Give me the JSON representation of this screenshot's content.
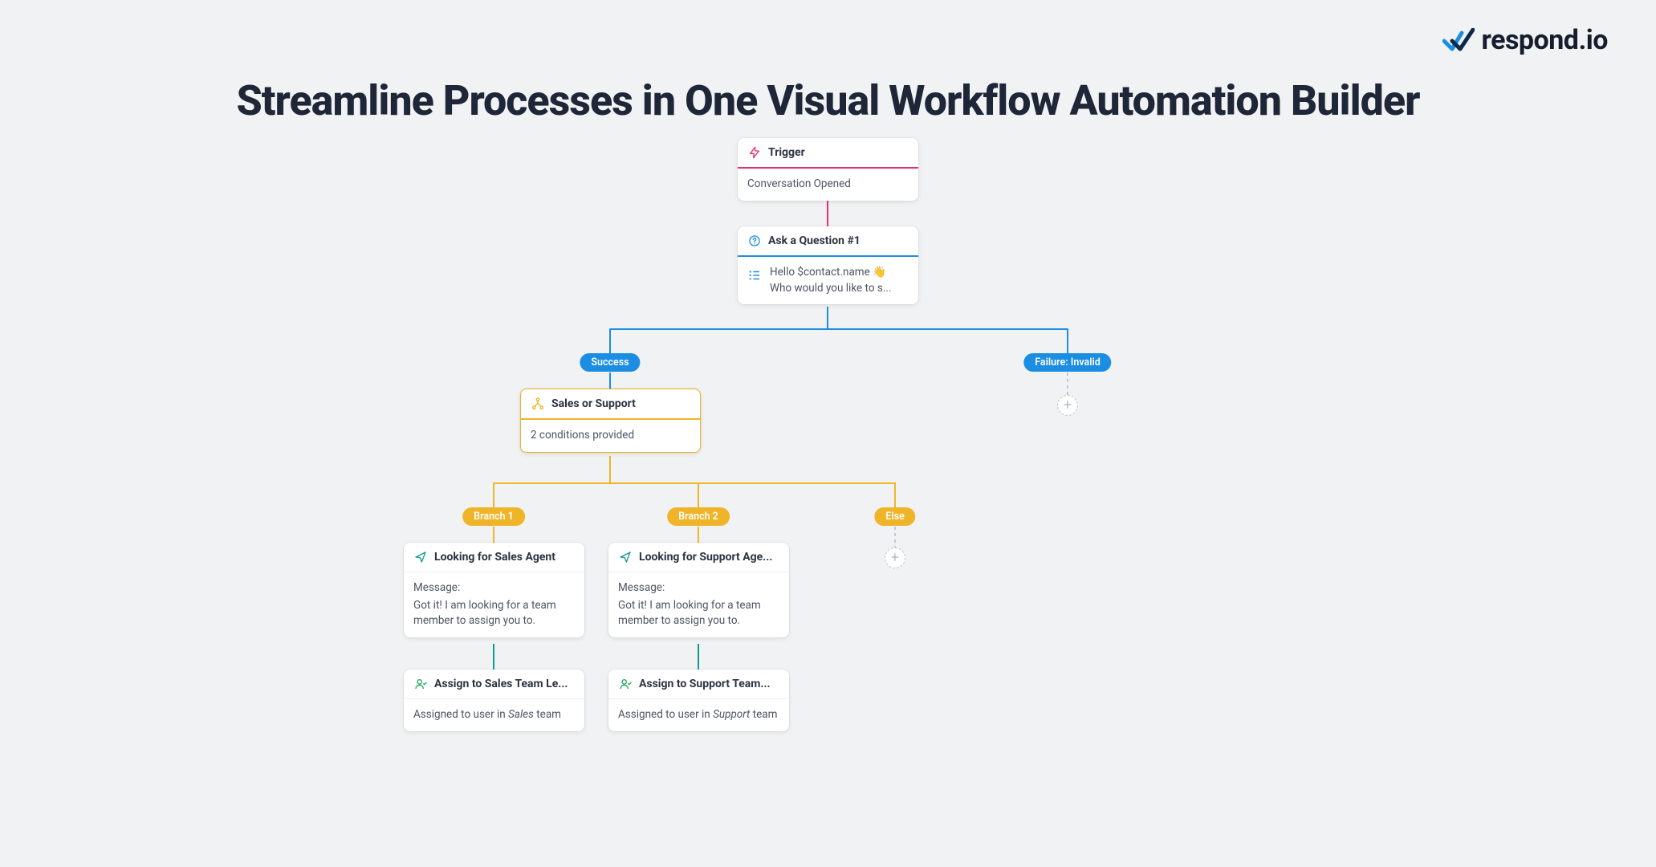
{
  "brand": {
    "name": "respond.io"
  },
  "page": {
    "title": "Streamline Processes in One Visual Workflow Automation Builder"
  },
  "nodes": {
    "trigger": {
      "title": "Trigger",
      "body": "Conversation Opened"
    },
    "question": {
      "title": "Ask a Question #1",
      "line1": "Hello $contact.name 👋",
      "line2": "Who would you like to s..."
    },
    "branch": {
      "title": "Sales or Support",
      "body": "2 conditions provided"
    },
    "msgSales": {
      "title": "Looking for Sales Agent",
      "label": "Message:",
      "body": "Got it! I am looking for a team member to assign you to."
    },
    "msgSupport": {
      "title": "Looking for Support Age...",
      "label": "Message:",
      "body": "Got it! I am looking for a team member to assign you to."
    },
    "assignSales": {
      "title": "Assign to Sales Team Le...",
      "prefix": "Assigned to user in ",
      "team": "Sales",
      "suffix": " team"
    },
    "assignSupport": {
      "title": "Assign to Support Team...",
      "prefix": "Assigned to user in ",
      "team": "Support",
      "suffix": " team"
    }
  },
  "pills": {
    "success": "Success",
    "failure": "Failure: Invalid",
    "branch1": "Branch 1",
    "branch2": "Branch 2",
    "else": "Else"
  },
  "colors": {
    "pink": "#e5306f",
    "blue": "#1b8de3",
    "amber": "#f0b429",
    "teal": "#0f9b8e",
    "green": "#22a65a",
    "gray": "#c3c9d2"
  }
}
